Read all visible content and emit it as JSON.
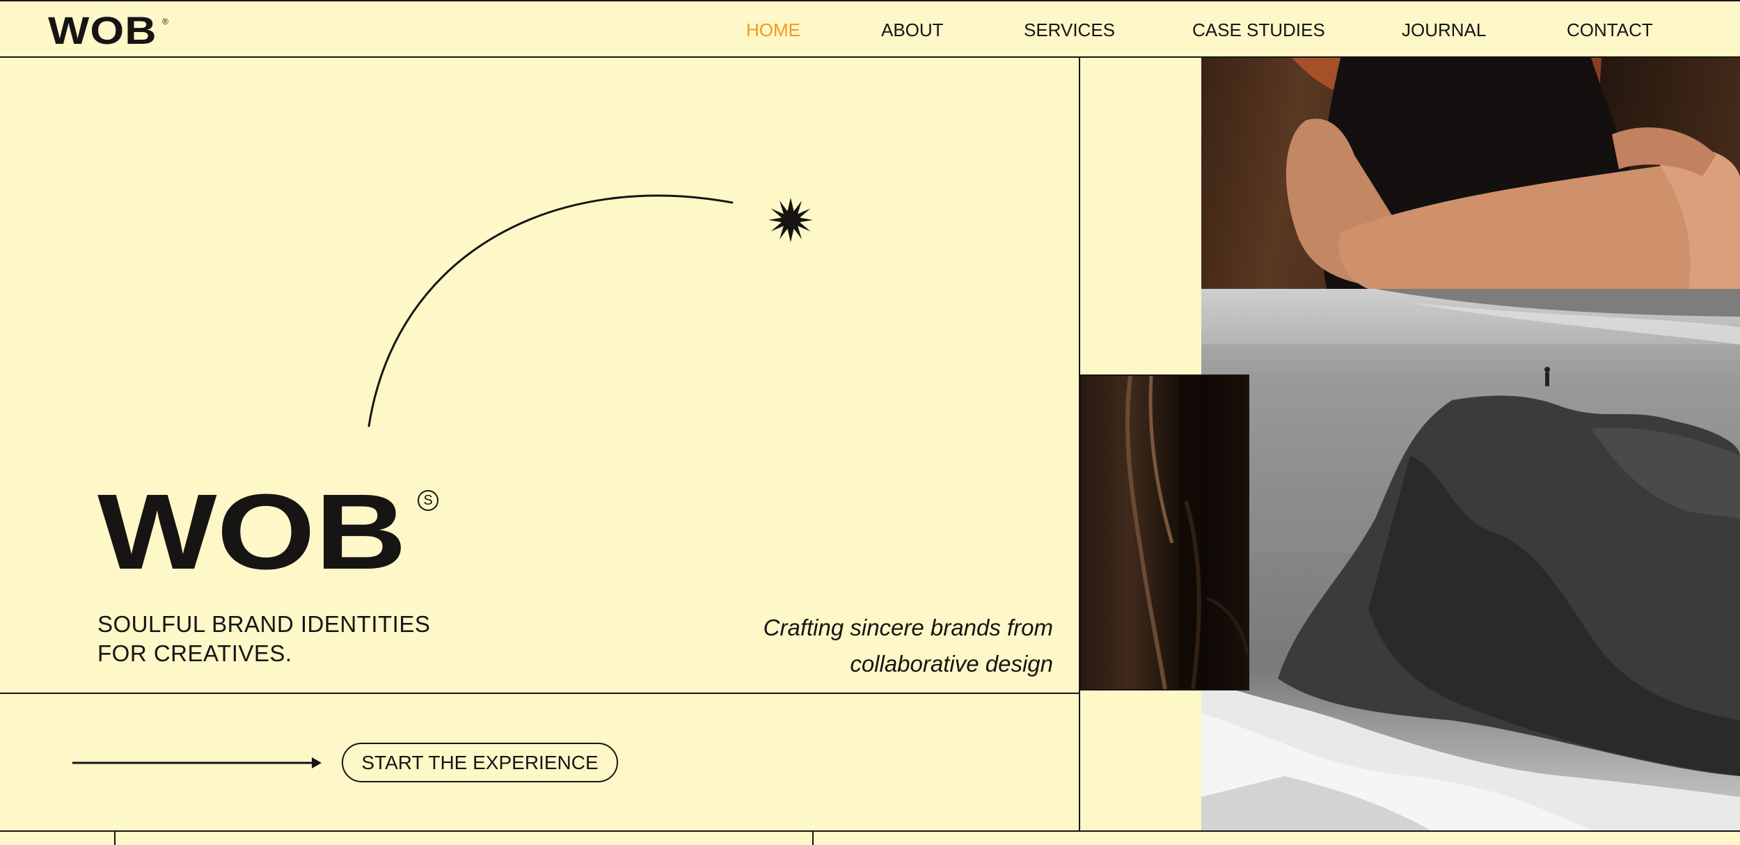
{
  "header": {
    "logo": "WOB",
    "logo_mark": "®",
    "nav": [
      {
        "label": "HOME",
        "active": true
      },
      {
        "label": "ABOUT",
        "active": false
      },
      {
        "label": "SERVICES",
        "active": false
      },
      {
        "label": "CASE STUDIES",
        "active": false
      },
      {
        "label": "JOURNAL",
        "active": false
      },
      {
        "label": "CONTACT",
        "active": false
      }
    ]
  },
  "hero": {
    "logo": "WOB",
    "logo_mark": "S",
    "tagline_line1": "SOULFUL BRAND IDENTITIES",
    "tagline_line2": "FOR CREATIVES.",
    "subtitle_line1": "Crafting sincere brands from",
    "subtitle_line2": "collaborative design",
    "cta_label": "START THE EXPERIENCE"
  },
  "icons": {
    "burst": "starburst-icon",
    "arrow": "arrow-right-icon"
  },
  "colors": {
    "background": "#FEF7C8",
    "ink": "#161514",
    "accent": "#F29B1A"
  }
}
